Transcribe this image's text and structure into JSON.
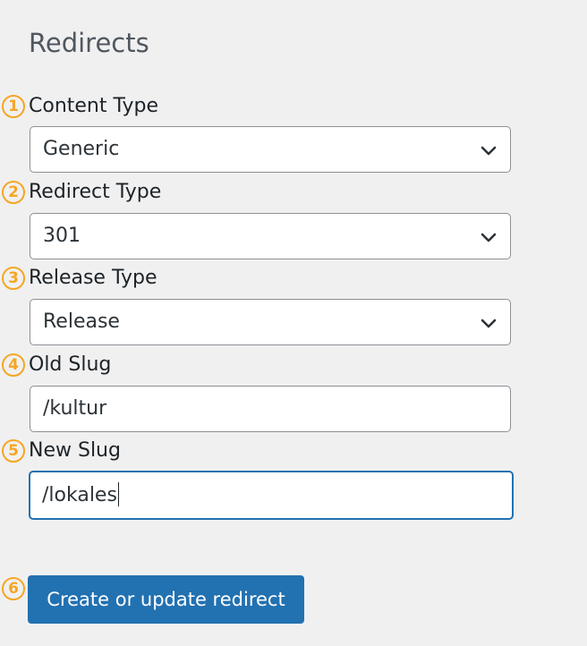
{
  "page": {
    "title": "Redirects"
  },
  "badges": [
    "1",
    "2",
    "3",
    "4",
    "5",
    "6"
  ],
  "fields": {
    "content_type": {
      "label": "Content Type",
      "value": "Generic"
    },
    "redirect_type": {
      "label": "Redirect Type",
      "value": "301"
    },
    "release_type": {
      "label": "Release Type",
      "value": "Release"
    },
    "old_slug": {
      "label": "Old Slug",
      "value": "/kultur"
    },
    "new_slug": {
      "label": "New Slug",
      "value": "/lokales"
    }
  },
  "submit": {
    "label": "Create or update redirect"
  },
  "colors": {
    "accent": "#2271b1",
    "badge": "#f5a623",
    "background": "#f0f0f1"
  },
  "icons": {
    "select_arrow": "chevron-down-icon"
  }
}
